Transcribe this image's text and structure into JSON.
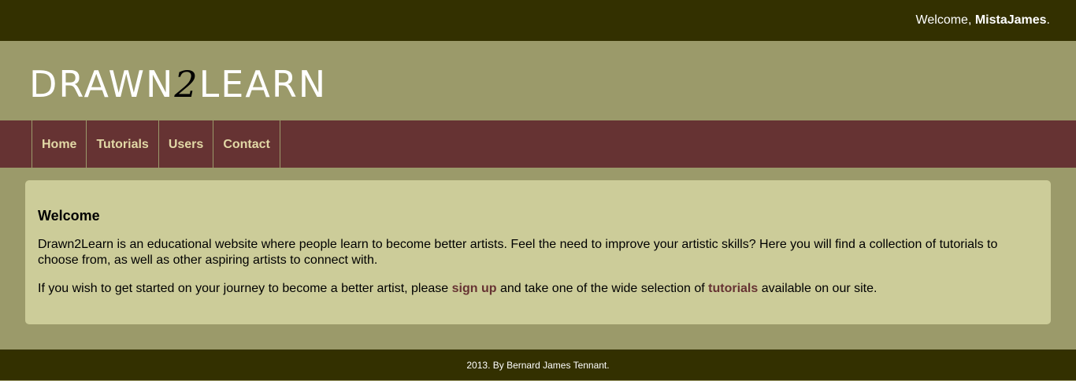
{
  "topbar": {
    "welcome_prefix": "Welcome, ",
    "username": "MistaJames",
    "welcome_suffix": "."
  },
  "logo": {
    "part1": "DRAWN",
    "part2": "2",
    "part3": "LEARN"
  },
  "nav": {
    "items": [
      {
        "label": "Home"
      },
      {
        "label": "Tutorials"
      },
      {
        "label": "Users"
      },
      {
        "label": "Contact"
      }
    ]
  },
  "main": {
    "heading": "Welcome",
    "intro": "Drawn2Learn is an educational website where people learn to become better artists. Feel the need to improve your artistic skills? Here you will find a collection of tutorials to choose from, as well as other aspiring artists to connect with.",
    "cta_before": "If you wish to get started on your journey to become a better artist, please ",
    "signup_link": "sign up",
    "cta_middle": " and take one of the wide selection of ",
    "tutorials_link": "tutorials",
    "cta_after": " available on our site."
  },
  "footer": {
    "text": "2013. By Bernard James Tennant."
  },
  "colors": {
    "topbar": "#333000",
    "header": "#9b9a6a",
    "nav": "#663333",
    "nav_text": "#e2d8a6",
    "content_bg": "#cccc99",
    "link": "#663333"
  }
}
